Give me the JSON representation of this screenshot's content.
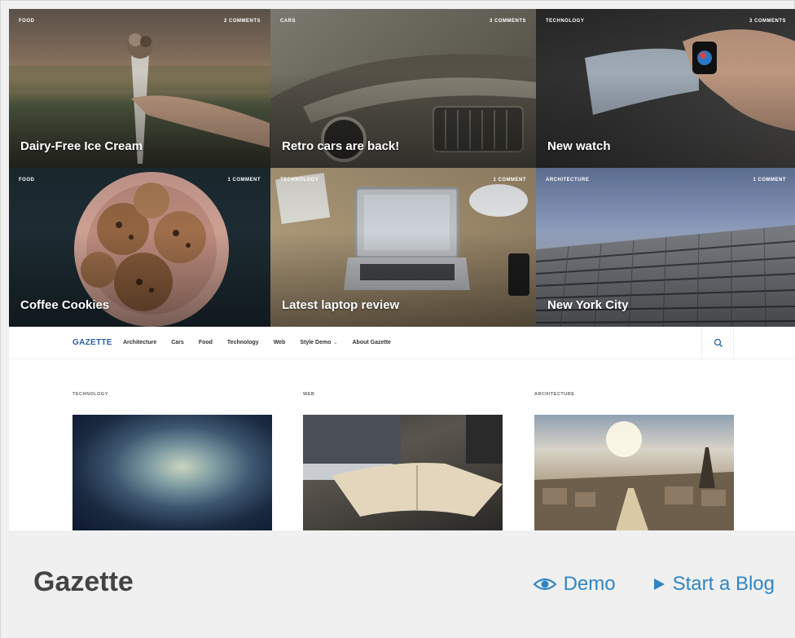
{
  "hero_tiles": [
    {
      "category": "FOOD",
      "comments": "2 COMMENTS",
      "title": "Dairy-Free Ice Cream"
    },
    {
      "category": "CARS",
      "comments": "3 COMMENTS",
      "title": "Retro cars are back!"
    },
    {
      "category": "TECHNOLOGY",
      "comments": "3 COMMENTS",
      "title": "New watch"
    },
    {
      "category": "FOOD",
      "comments": "1 COMMENT",
      "title": "Coffee Cookies"
    },
    {
      "category": "TECHNOLOGY",
      "comments": "1 COMMENT",
      "title": "Latest laptop review"
    },
    {
      "category": "ARCHITECTURE",
      "comments": "1 COMMENT",
      "title": "New York City"
    }
  ],
  "nav": {
    "brand": "GAZETTE",
    "items": [
      "Architecture",
      "Cars",
      "Food",
      "Technology",
      "Web",
      "Style Demo",
      "About Gazette"
    ],
    "search_icon": "search-icon"
  },
  "posts": [
    {
      "category": "TECHNOLOGY"
    },
    {
      "category": "WEB"
    },
    {
      "category": "ARCHITECTURE"
    }
  ],
  "footer": {
    "theme_name": "Gazette",
    "demo_label": "Demo",
    "start_label": "Start a Blog",
    "demo_icon": "eye-icon",
    "start_icon": "play-icon",
    "accent": "#2f86c6"
  }
}
